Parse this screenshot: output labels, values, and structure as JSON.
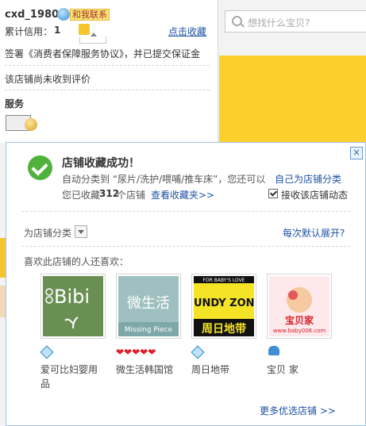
{
  "shop_card": {
    "shop_name": "cxd_1980",
    "contact_label": "和我联系",
    "credit_label": "累计信用：",
    "credit_value": "1",
    "favorite_link": "点击收藏",
    "agreement_text": "签署《消费者保障服务协议》，并已提交保证金",
    "no_review_text": "该店铺尚未收到评价",
    "service_title": "服务"
  },
  "search": {
    "placeholder": "想找什么宝贝?"
  },
  "popup": {
    "close_icon": "close-icon",
    "success_title": "店铺收藏成功！",
    "auto_category_text": "自动分类到 “尿片/洗护/喂哺/推车床”，您还可以",
    "category_link": "自己为店铺分类",
    "saved_prefix": "您已收藏",
    "saved_count": "312",
    "saved_suffix": "个店铺",
    "view_favorites_link": "查看收藏夹>>",
    "receive_updates_label": "接收该店铺动态",
    "receive_updates_checked": true,
    "shop_category_label": "为店铺分类",
    "default_expand_link": "每次默认展开?",
    "also_like_title": "喜欢此店铺的人还喜欢：",
    "shops": [
      {
        "name": "爱可比妇婴用品",
        "logo_text": "Bibi",
        "rating": "diamond",
        "rating_count": 1
      },
      {
        "name": "微生活韩国馆",
        "logo_text": "微生活",
        "logo_subtext": "Missing Piece",
        "rating": "heart",
        "rating_count": 5
      },
      {
        "name": "周日地带",
        "logo_text": "SUNDY ZONE",
        "logo_subtext": "周日地带",
        "logo_top": "FOR BABY'S LOVE",
        "rating": "diamond",
        "rating_count": 1
      },
      {
        "name": "宝贝 家",
        "logo_text": "宝贝家",
        "logo_subtext": "www.baby006.com",
        "rating": "crown",
        "rating_count": 1
      }
    ],
    "more_shops_link": "更多优选店铺 >>"
  },
  "colors": {
    "link": "#1d52a4",
    "success_green": "#4fb23a",
    "banner_yellow": "#fbcf2c",
    "popup_border": "#9fc3e6"
  }
}
